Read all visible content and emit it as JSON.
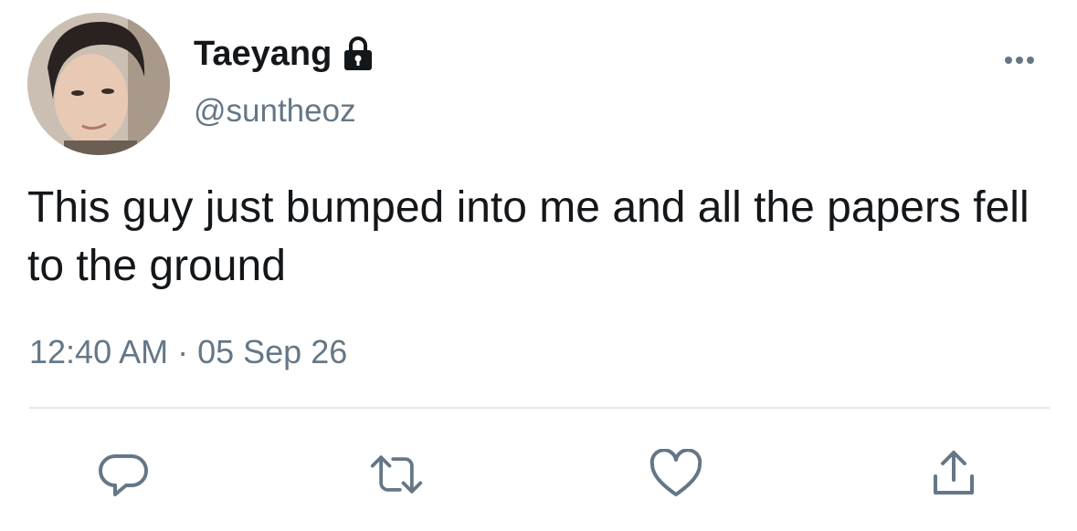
{
  "user": {
    "display_name": "Taeyang",
    "handle": "@suntheoz",
    "protected_icon": "lock-icon",
    "avatar": "avatar-photo"
  },
  "tweet": {
    "text": "This guy just bumped into me and all the papers fell to the ground",
    "timestamp": "12:40 AM · 05 Sep 26"
  },
  "actions": [
    {
      "name": "reply",
      "icon": "reply-icon"
    },
    {
      "name": "retweet",
      "icon": "retweet-icon"
    },
    {
      "name": "like",
      "icon": "heart-icon"
    },
    {
      "name": "share",
      "icon": "share-icon"
    }
  ],
  "menu_icon": "more-options-icon",
  "colors": {
    "text_primary": "#14171a",
    "text_secondary": "#657786",
    "divider": "#e1e8ed"
  }
}
